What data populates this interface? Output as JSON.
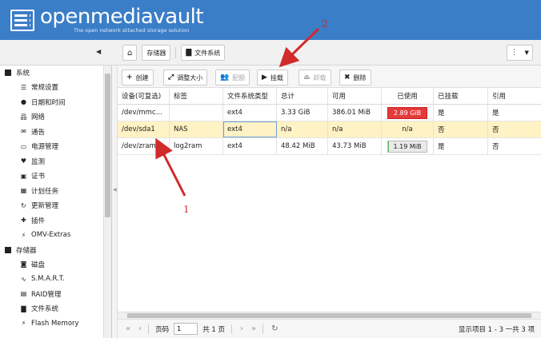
{
  "header": {
    "brand": "openmediavault",
    "tagline": "The open network attached storage solution"
  },
  "topbar": {
    "breadcrumbs": [
      "存储器",
      "文件系统"
    ]
  },
  "sidebar": {
    "groups": [
      {
        "label": "系统",
        "items": [
          {
            "label": "常规设置",
            "icon": "sliders-icon"
          },
          {
            "label": "日期和时间",
            "icon": "clock-icon"
          },
          {
            "label": "网络",
            "icon": "network-icon"
          },
          {
            "label": "通告",
            "icon": "envelope-icon"
          },
          {
            "label": "电源管理",
            "icon": "battery-icon"
          },
          {
            "label": "监测",
            "icon": "heartbeat-icon"
          },
          {
            "label": "证书",
            "icon": "certificate-icon"
          },
          {
            "label": "计划任务",
            "icon": "calendar-icon"
          },
          {
            "label": "更新管理",
            "icon": "refresh-icon"
          },
          {
            "label": "插件",
            "icon": "puzzle-icon"
          },
          {
            "label": "OMV-Extras",
            "icon": "plug-icon"
          }
        ]
      },
      {
        "label": "存储器",
        "items": [
          {
            "label": "磁盘",
            "icon": "disk-icon"
          },
          {
            "label": "S.M.A.R.T.",
            "icon": "pulse-icon"
          },
          {
            "label": "RAID管理",
            "icon": "raid-icon"
          },
          {
            "label": "文件系统",
            "icon": "folder-icon"
          },
          {
            "label": "Flash Memory",
            "icon": "bolt-icon"
          }
        ]
      }
    ]
  },
  "actions": {
    "create": "创建",
    "resize": "调整大小",
    "delete_quota": "配额",
    "mount": "挂载",
    "unmount": "卸载",
    "delete": "删除"
  },
  "grid": {
    "columns": [
      "设备(可复选)",
      "标签",
      "文件系统类型",
      "总计",
      "可用",
      "已使用",
      "已挂载",
      "引用"
    ],
    "rows": [
      {
        "device": "/dev/mmc...",
        "label": "",
        "fstype": "ext4",
        "total": "3.33 GiB",
        "available": "386.01 MiB",
        "used": "2.89 GiB",
        "used_fraction": 0.88,
        "mounted": "是",
        "referenced": "是",
        "selected": false
      },
      {
        "device": "/dev/sda1",
        "label": "NAS",
        "fstype": "ext4",
        "total": "n/a",
        "available": "n/a",
        "used": "n/a",
        "used_fraction": null,
        "mounted": "否",
        "referenced": "否",
        "selected": true
      },
      {
        "device": "/dev/zram...",
        "label": "log2ram",
        "fstype": "ext4",
        "total": "48.42 MiB",
        "available": "43.73 MiB",
        "used": "1.19 MiB",
        "used_fraction": 0.02,
        "mounted": "是",
        "referenced": "否",
        "selected": false
      }
    ]
  },
  "pager": {
    "page_label": "页码",
    "page_value": "1",
    "total_pages": "共 1 页",
    "info": "显示项目 1 - 3 一共 3 项"
  },
  "annotations": {
    "arrow1": "1",
    "arrow2": "2"
  },
  "colors": {
    "header": "#3b7ec8",
    "selected_row": "#fff2c5",
    "used_red": "#e33a3a",
    "used_green": "#5bb85b",
    "annotation": "#d12a2a"
  }
}
